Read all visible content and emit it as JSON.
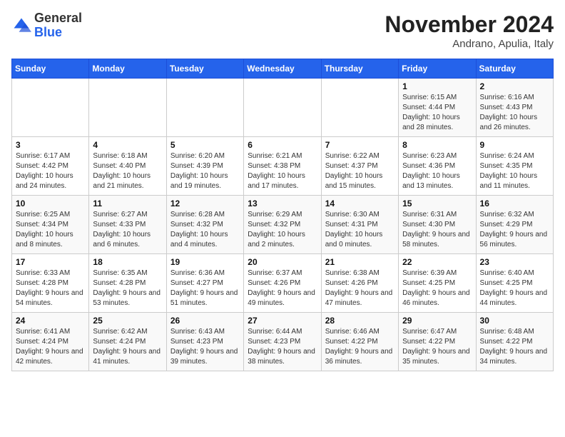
{
  "logo": {
    "general": "General",
    "blue": "Blue"
  },
  "title": "November 2024",
  "location": "Andrano, Apulia, Italy",
  "days_header": [
    "Sunday",
    "Monday",
    "Tuesday",
    "Wednesday",
    "Thursday",
    "Friday",
    "Saturday"
  ],
  "weeks": [
    [
      {
        "num": "",
        "info": ""
      },
      {
        "num": "",
        "info": ""
      },
      {
        "num": "",
        "info": ""
      },
      {
        "num": "",
        "info": ""
      },
      {
        "num": "",
        "info": ""
      },
      {
        "num": "1",
        "info": "Sunrise: 6:15 AM\nSunset: 4:44 PM\nDaylight: 10 hours and 28 minutes."
      },
      {
        "num": "2",
        "info": "Sunrise: 6:16 AM\nSunset: 4:43 PM\nDaylight: 10 hours and 26 minutes."
      }
    ],
    [
      {
        "num": "3",
        "info": "Sunrise: 6:17 AM\nSunset: 4:42 PM\nDaylight: 10 hours and 24 minutes."
      },
      {
        "num": "4",
        "info": "Sunrise: 6:18 AM\nSunset: 4:40 PM\nDaylight: 10 hours and 21 minutes."
      },
      {
        "num": "5",
        "info": "Sunrise: 6:20 AM\nSunset: 4:39 PM\nDaylight: 10 hours and 19 minutes."
      },
      {
        "num": "6",
        "info": "Sunrise: 6:21 AM\nSunset: 4:38 PM\nDaylight: 10 hours and 17 minutes."
      },
      {
        "num": "7",
        "info": "Sunrise: 6:22 AM\nSunset: 4:37 PM\nDaylight: 10 hours and 15 minutes."
      },
      {
        "num": "8",
        "info": "Sunrise: 6:23 AM\nSunset: 4:36 PM\nDaylight: 10 hours and 13 minutes."
      },
      {
        "num": "9",
        "info": "Sunrise: 6:24 AM\nSunset: 4:35 PM\nDaylight: 10 hours and 11 minutes."
      }
    ],
    [
      {
        "num": "10",
        "info": "Sunrise: 6:25 AM\nSunset: 4:34 PM\nDaylight: 10 hours and 8 minutes."
      },
      {
        "num": "11",
        "info": "Sunrise: 6:27 AM\nSunset: 4:33 PM\nDaylight: 10 hours and 6 minutes."
      },
      {
        "num": "12",
        "info": "Sunrise: 6:28 AM\nSunset: 4:32 PM\nDaylight: 10 hours and 4 minutes."
      },
      {
        "num": "13",
        "info": "Sunrise: 6:29 AM\nSunset: 4:32 PM\nDaylight: 10 hours and 2 minutes."
      },
      {
        "num": "14",
        "info": "Sunrise: 6:30 AM\nSunset: 4:31 PM\nDaylight: 10 hours and 0 minutes."
      },
      {
        "num": "15",
        "info": "Sunrise: 6:31 AM\nSunset: 4:30 PM\nDaylight: 9 hours and 58 minutes."
      },
      {
        "num": "16",
        "info": "Sunrise: 6:32 AM\nSunset: 4:29 PM\nDaylight: 9 hours and 56 minutes."
      }
    ],
    [
      {
        "num": "17",
        "info": "Sunrise: 6:33 AM\nSunset: 4:28 PM\nDaylight: 9 hours and 54 minutes."
      },
      {
        "num": "18",
        "info": "Sunrise: 6:35 AM\nSunset: 4:28 PM\nDaylight: 9 hours and 53 minutes."
      },
      {
        "num": "19",
        "info": "Sunrise: 6:36 AM\nSunset: 4:27 PM\nDaylight: 9 hours and 51 minutes."
      },
      {
        "num": "20",
        "info": "Sunrise: 6:37 AM\nSunset: 4:26 PM\nDaylight: 9 hours and 49 minutes."
      },
      {
        "num": "21",
        "info": "Sunrise: 6:38 AM\nSunset: 4:26 PM\nDaylight: 9 hours and 47 minutes."
      },
      {
        "num": "22",
        "info": "Sunrise: 6:39 AM\nSunset: 4:25 PM\nDaylight: 9 hours and 46 minutes."
      },
      {
        "num": "23",
        "info": "Sunrise: 6:40 AM\nSunset: 4:25 PM\nDaylight: 9 hours and 44 minutes."
      }
    ],
    [
      {
        "num": "24",
        "info": "Sunrise: 6:41 AM\nSunset: 4:24 PM\nDaylight: 9 hours and 42 minutes."
      },
      {
        "num": "25",
        "info": "Sunrise: 6:42 AM\nSunset: 4:24 PM\nDaylight: 9 hours and 41 minutes."
      },
      {
        "num": "26",
        "info": "Sunrise: 6:43 AM\nSunset: 4:23 PM\nDaylight: 9 hours and 39 minutes."
      },
      {
        "num": "27",
        "info": "Sunrise: 6:44 AM\nSunset: 4:23 PM\nDaylight: 9 hours and 38 minutes."
      },
      {
        "num": "28",
        "info": "Sunrise: 6:46 AM\nSunset: 4:22 PM\nDaylight: 9 hours and 36 minutes."
      },
      {
        "num": "29",
        "info": "Sunrise: 6:47 AM\nSunset: 4:22 PM\nDaylight: 9 hours and 35 minutes."
      },
      {
        "num": "30",
        "info": "Sunrise: 6:48 AM\nSunset: 4:22 PM\nDaylight: 9 hours and 34 minutes."
      }
    ]
  ]
}
